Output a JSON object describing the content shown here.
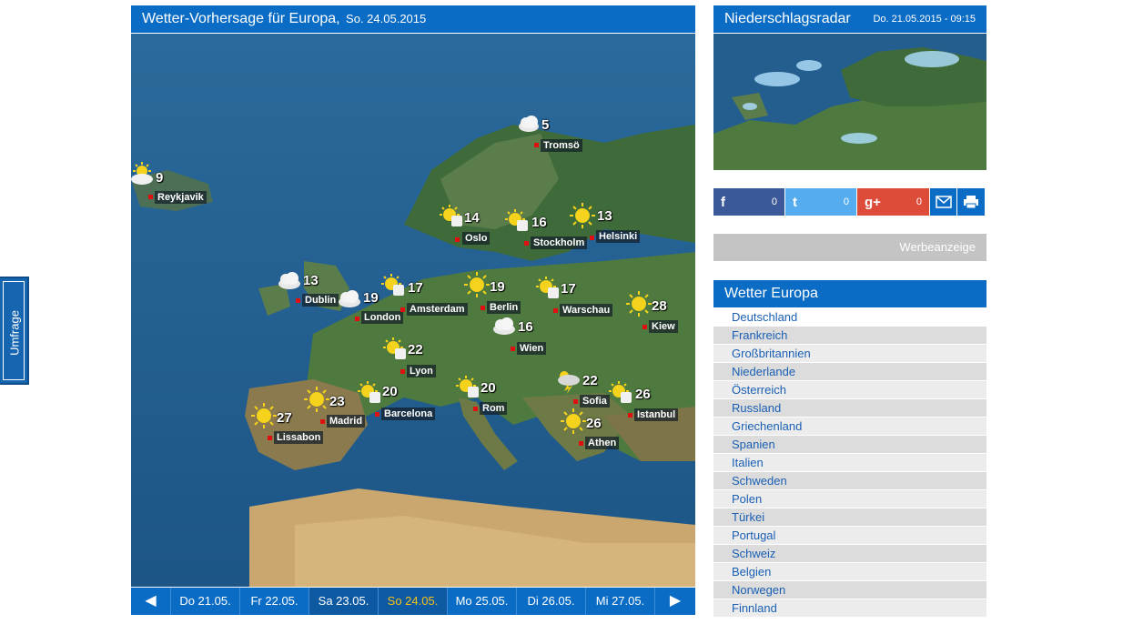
{
  "side_tab": {
    "label": "Umfrage"
  },
  "main": {
    "title": "Wetter-Vorhersage für Europa,",
    "date": "So. 24.05.2015",
    "cities": [
      {
        "name": "Tromsö",
        "temp": "5",
        "icon": "cloud-icon"
      },
      {
        "name": "Reykjavik",
        "temp": "9",
        "icon": "sun-cloud-icon"
      },
      {
        "name": "Oslo",
        "temp": "14",
        "icon": "sun-cloud-icon"
      },
      {
        "name": "Stockholm",
        "temp": "16",
        "icon": "sun-cloud-icon"
      },
      {
        "name": "Helsinki",
        "temp": "13",
        "icon": "sun-icon"
      },
      {
        "name": "Dublin",
        "temp": "13",
        "icon": "cloud-icon"
      },
      {
        "name": "London",
        "temp": "19",
        "icon": "cloud-icon"
      },
      {
        "name": "Amsterdam",
        "temp": "17",
        "icon": "sun-cloud-icon"
      },
      {
        "name": "Berlin",
        "temp": "19",
        "icon": "sun-icon"
      },
      {
        "name": "Warschau",
        "temp": "17",
        "icon": "sun-cloud-icon"
      },
      {
        "name": "Kiew",
        "temp": "28",
        "icon": "sun-icon"
      },
      {
        "name": "Wien",
        "temp": "16",
        "icon": "cloud-icon"
      },
      {
        "name": "Lyon",
        "temp": "22",
        "icon": "sun-cloud-icon"
      },
      {
        "name": "Sofia",
        "temp": "22",
        "icon": "storm-icon"
      },
      {
        "name": "Istanbul",
        "temp": "26",
        "icon": "sun-cloud-icon"
      },
      {
        "name": "Madrid",
        "temp": "23",
        "icon": "sun-icon"
      },
      {
        "name": "Barcelona",
        "temp": "20",
        "icon": "sun-cloud-icon"
      },
      {
        "name": "Rom",
        "temp": "20",
        "icon": "sun-cloud-icon"
      },
      {
        "name": "Lissabon",
        "temp": "27",
        "icon": "sun-icon"
      },
      {
        "name": "Athen",
        "temp": "26",
        "icon": "sun-icon"
      }
    ],
    "days": {
      "prev": "◀",
      "next": "▶",
      "items": [
        "Do 21.05.",
        "Fr 22.05.",
        "Sa 23.05.",
        "So 24.05.",
        "Mo 25.05.",
        "Di 26.05.",
        "Mi 27.05."
      ],
      "active_index": 3
    }
  },
  "radar": {
    "title": "Niederschlagsradar",
    "timestamp": "Do. 21.05.2015 - 09:15"
  },
  "social": [
    {
      "icon": "f",
      "count": "0",
      "color": "#3b5998",
      "name": "facebook"
    },
    {
      "icon": "t",
      "count": "0",
      "color": "#55acee",
      "name": "twitter"
    },
    {
      "icon": "g+",
      "count": "0",
      "color": "#dd4b39",
      "name": "google-plus"
    }
  ],
  "colors": {
    "accent": "#0a6cc5",
    "active_day": "#f5c21b"
  },
  "ad": {
    "label": "Werbeanzeige"
  },
  "europe": {
    "title": "Wetter Europa",
    "countries": [
      "Deutschland",
      "Frankreich",
      "Großbritannien",
      "Niederlande",
      "Österreich",
      "Russland",
      "Griechenland",
      "Spanien",
      "Italien",
      "Schweden",
      "Polen",
      "Türkei",
      "Portugal",
      "Schweiz",
      "Belgien",
      "Norwegen",
      "Finnland"
    ]
  }
}
